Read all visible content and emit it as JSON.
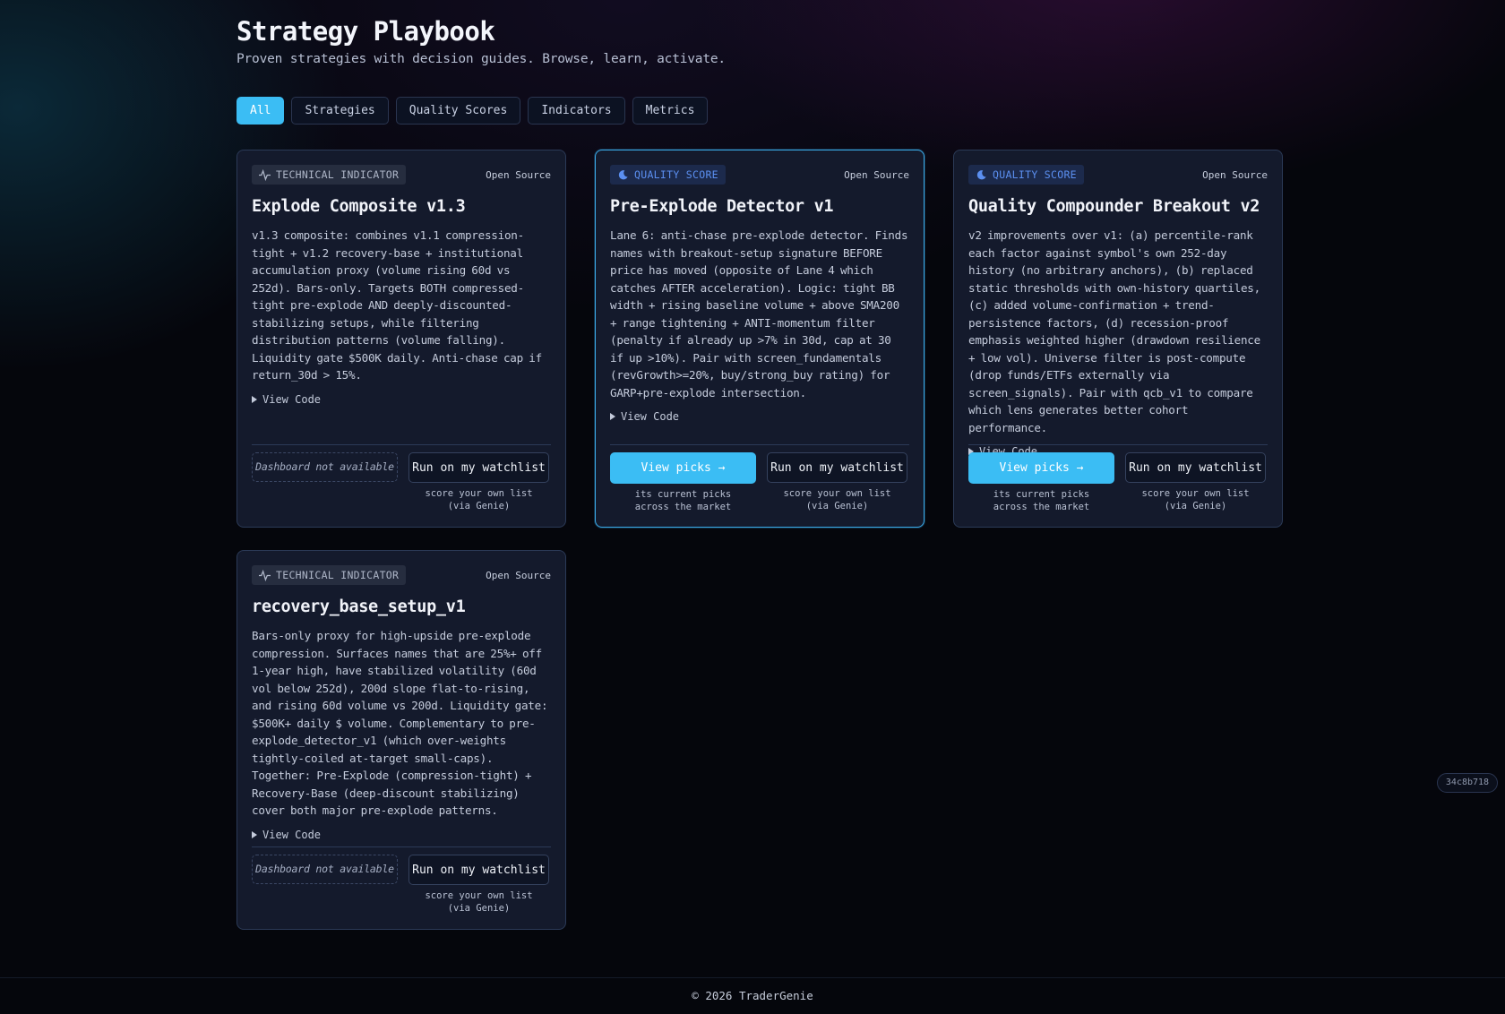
{
  "header": {
    "title": "Strategy Playbook",
    "subtitle": "Proven strategies with decision guides. Browse, learn, activate."
  },
  "filters": [
    "All",
    "Strategies",
    "Quality Scores",
    "Indicators",
    "Metrics"
  ],
  "active_filter": "All",
  "cards": [
    {
      "badge": "TECHNICAL INDICATOR",
      "license": "Open Source",
      "title": "Explode Composite v1.3",
      "description": "v1.3 composite: combines v1.1 compression-tight + v1.2 recovery-base + institutional accumulation proxy (volume rising 60d vs 252d). Bars-only. Targets BOTH compressed-tight pre-explode AND deeply-discounted-stabilizing setups, while filtering distribution patterns (volume falling). Liquidity gate $500K daily. Anti-chase cap if return_30d > 15%.",
      "view_code": "View Code",
      "primary_label": "Dashboard not available",
      "primary_hint": "",
      "secondary_label": "Run on my watchlist",
      "secondary_hint": "score your own list (via Genie)"
    },
    {
      "badge": "QUALITY SCORE",
      "license": "Open Source",
      "title": "Pre-Explode Detector v1",
      "description": "Lane 6: anti-chase pre-explode detector. Finds names with breakout-setup signature BEFORE price has moved (opposite of Lane 4 which catches AFTER acceleration). Logic: tight BB width + rising baseline volume + above SMA200 + range tightening + ANTI-momentum filter (penalty if already up >7% in 30d, cap at 30 if up >10%). Pair with screen_fundamentals (revGrowth>=20%, buy/strong_buy rating) for GARP+pre-explode intersection.",
      "view_code": "View Code",
      "primary_label": "View picks →",
      "primary_hint": "its current picks across the market",
      "secondary_label": "Run on my watchlist",
      "secondary_hint": "score your own list (via Genie)"
    },
    {
      "badge": "QUALITY SCORE",
      "license": "Open Source",
      "title": "Quality Compounder Breakout v2",
      "description": "v2 improvements over v1: (a) percentile-rank each factor against symbol's own 252-day history (no arbitrary anchors), (b) replaced static thresholds with own-history quartiles, (c) added volume-confirmation + trend-persistence factors, (d) recession-proof emphasis weighted higher (drawdown resilience + low vol). Universe filter is post-compute (drop funds/ETFs externally via screen_signals). Pair with qcb_v1 to compare which lens generates better cohort performance.",
      "view_code": "View Code",
      "primary_label": "View picks →",
      "primary_hint": "its current picks across the market",
      "secondary_label": "Run on my watchlist",
      "secondary_hint": "score your own list (via Genie)"
    },
    {
      "badge": "TECHNICAL INDICATOR",
      "license": "Open Source",
      "title": "recovery_base_setup_v1",
      "description": "Bars-only proxy for high-upside pre-explode compression. Surfaces names that are 25%+ off 1-year high, have stabilized volatility (60d vol below 252d), 200d slope flat-to-rising, and rising 60d volume vs 200d. Liquidity gate: $500K+ daily $ volume. Complementary to pre-explode_detector_v1 (which over-weights tightly-coiled at-target small-caps). Together: Pre-Explode (compression-tight) + Recovery-Base (deep-discount stabilizing) cover both major pre-explode patterns.",
      "view_code": "View Code",
      "primary_label": "Dashboard not available",
      "primary_hint": "",
      "secondary_label": "Run on my watchlist",
      "secondary_hint": "score your own list (via Genie)"
    }
  ],
  "version": "34c8b718",
  "footer": "© 2026 TraderGenie",
  "colors": {
    "accent": "#3bbdf4",
    "card_bg": "#141a2c",
    "card_border": "#2b3a57",
    "quality_badge": "#5b8ff0"
  }
}
